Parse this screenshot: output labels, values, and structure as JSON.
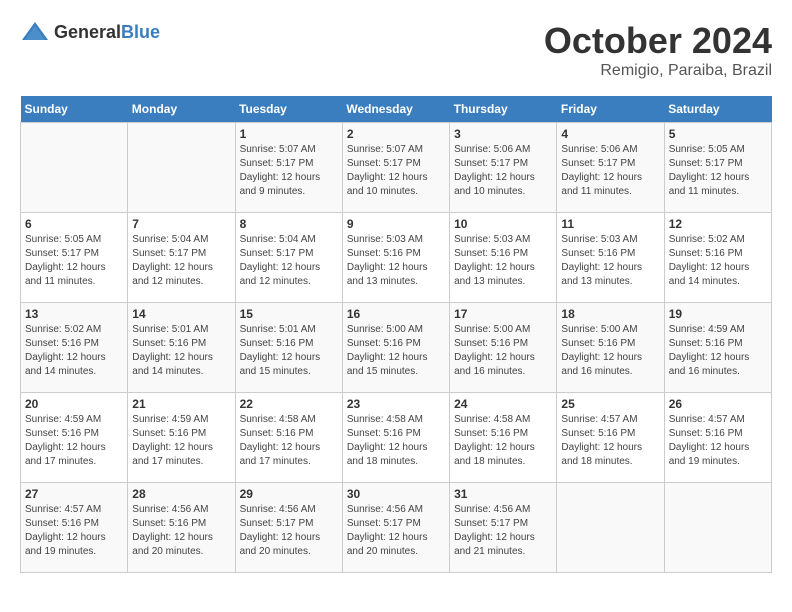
{
  "header": {
    "logo_general": "General",
    "logo_blue": "Blue",
    "title": "October 2024",
    "subtitle": "Remigio, Paraiba, Brazil"
  },
  "calendar": {
    "days_of_week": [
      "Sunday",
      "Monday",
      "Tuesday",
      "Wednesday",
      "Thursday",
      "Friday",
      "Saturday"
    ],
    "weeks": [
      [
        {
          "day": "",
          "sunrise": "",
          "sunset": "",
          "daylight": ""
        },
        {
          "day": "",
          "sunrise": "",
          "sunset": "",
          "daylight": ""
        },
        {
          "day": "1",
          "sunrise": "Sunrise: 5:07 AM",
          "sunset": "Sunset: 5:17 PM",
          "daylight": "Daylight: 12 hours and 9 minutes."
        },
        {
          "day": "2",
          "sunrise": "Sunrise: 5:07 AM",
          "sunset": "Sunset: 5:17 PM",
          "daylight": "Daylight: 12 hours and 10 minutes."
        },
        {
          "day": "3",
          "sunrise": "Sunrise: 5:06 AM",
          "sunset": "Sunset: 5:17 PM",
          "daylight": "Daylight: 12 hours and 10 minutes."
        },
        {
          "day": "4",
          "sunrise": "Sunrise: 5:06 AM",
          "sunset": "Sunset: 5:17 PM",
          "daylight": "Daylight: 12 hours and 11 minutes."
        },
        {
          "day": "5",
          "sunrise": "Sunrise: 5:05 AM",
          "sunset": "Sunset: 5:17 PM",
          "daylight": "Daylight: 12 hours and 11 minutes."
        }
      ],
      [
        {
          "day": "6",
          "sunrise": "Sunrise: 5:05 AM",
          "sunset": "Sunset: 5:17 PM",
          "daylight": "Daylight: 12 hours and 11 minutes."
        },
        {
          "day": "7",
          "sunrise": "Sunrise: 5:04 AM",
          "sunset": "Sunset: 5:17 PM",
          "daylight": "Daylight: 12 hours and 12 minutes."
        },
        {
          "day": "8",
          "sunrise": "Sunrise: 5:04 AM",
          "sunset": "Sunset: 5:17 PM",
          "daylight": "Daylight: 12 hours and 12 minutes."
        },
        {
          "day": "9",
          "sunrise": "Sunrise: 5:03 AM",
          "sunset": "Sunset: 5:16 PM",
          "daylight": "Daylight: 12 hours and 13 minutes."
        },
        {
          "day": "10",
          "sunrise": "Sunrise: 5:03 AM",
          "sunset": "Sunset: 5:16 PM",
          "daylight": "Daylight: 12 hours and 13 minutes."
        },
        {
          "day": "11",
          "sunrise": "Sunrise: 5:03 AM",
          "sunset": "Sunset: 5:16 PM",
          "daylight": "Daylight: 12 hours and 13 minutes."
        },
        {
          "day": "12",
          "sunrise": "Sunrise: 5:02 AM",
          "sunset": "Sunset: 5:16 PM",
          "daylight": "Daylight: 12 hours and 14 minutes."
        }
      ],
      [
        {
          "day": "13",
          "sunrise": "Sunrise: 5:02 AM",
          "sunset": "Sunset: 5:16 PM",
          "daylight": "Daylight: 12 hours and 14 minutes."
        },
        {
          "day": "14",
          "sunrise": "Sunrise: 5:01 AM",
          "sunset": "Sunset: 5:16 PM",
          "daylight": "Daylight: 12 hours and 14 minutes."
        },
        {
          "day": "15",
          "sunrise": "Sunrise: 5:01 AM",
          "sunset": "Sunset: 5:16 PM",
          "daylight": "Daylight: 12 hours and 15 minutes."
        },
        {
          "day": "16",
          "sunrise": "Sunrise: 5:00 AM",
          "sunset": "Sunset: 5:16 PM",
          "daylight": "Daylight: 12 hours and 15 minutes."
        },
        {
          "day": "17",
          "sunrise": "Sunrise: 5:00 AM",
          "sunset": "Sunset: 5:16 PM",
          "daylight": "Daylight: 12 hours and 16 minutes."
        },
        {
          "day": "18",
          "sunrise": "Sunrise: 5:00 AM",
          "sunset": "Sunset: 5:16 PM",
          "daylight": "Daylight: 12 hours and 16 minutes."
        },
        {
          "day": "19",
          "sunrise": "Sunrise: 4:59 AM",
          "sunset": "Sunset: 5:16 PM",
          "daylight": "Daylight: 12 hours and 16 minutes."
        }
      ],
      [
        {
          "day": "20",
          "sunrise": "Sunrise: 4:59 AM",
          "sunset": "Sunset: 5:16 PM",
          "daylight": "Daylight: 12 hours and 17 minutes."
        },
        {
          "day": "21",
          "sunrise": "Sunrise: 4:59 AM",
          "sunset": "Sunset: 5:16 PM",
          "daylight": "Daylight: 12 hours and 17 minutes."
        },
        {
          "day": "22",
          "sunrise": "Sunrise: 4:58 AM",
          "sunset": "Sunset: 5:16 PM",
          "daylight": "Daylight: 12 hours and 17 minutes."
        },
        {
          "day": "23",
          "sunrise": "Sunrise: 4:58 AM",
          "sunset": "Sunset: 5:16 PM",
          "daylight": "Daylight: 12 hours and 18 minutes."
        },
        {
          "day": "24",
          "sunrise": "Sunrise: 4:58 AM",
          "sunset": "Sunset: 5:16 PM",
          "daylight": "Daylight: 12 hours and 18 minutes."
        },
        {
          "day": "25",
          "sunrise": "Sunrise: 4:57 AM",
          "sunset": "Sunset: 5:16 PM",
          "daylight": "Daylight: 12 hours and 18 minutes."
        },
        {
          "day": "26",
          "sunrise": "Sunrise: 4:57 AM",
          "sunset": "Sunset: 5:16 PM",
          "daylight": "Daylight: 12 hours and 19 minutes."
        }
      ],
      [
        {
          "day": "27",
          "sunrise": "Sunrise: 4:57 AM",
          "sunset": "Sunset: 5:16 PM",
          "daylight": "Daylight: 12 hours and 19 minutes."
        },
        {
          "day": "28",
          "sunrise": "Sunrise: 4:56 AM",
          "sunset": "Sunset: 5:16 PM",
          "daylight": "Daylight: 12 hours and 20 minutes."
        },
        {
          "day": "29",
          "sunrise": "Sunrise: 4:56 AM",
          "sunset": "Sunset: 5:17 PM",
          "daylight": "Daylight: 12 hours and 20 minutes."
        },
        {
          "day": "30",
          "sunrise": "Sunrise: 4:56 AM",
          "sunset": "Sunset: 5:17 PM",
          "daylight": "Daylight: 12 hours and 20 minutes."
        },
        {
          "day": "31",
          "sunrise": "Sunrise: 4:56 AM",
          "sunset": "Sunset: 5:17 PM",
          "daylight": "Daylight: 12 hours and 21 minutes."
        },
        {
          "day": "",
          "sunrise": "",
          "sunset": "",
          "daylight": ""
        },
        {
          "day": "",
          "sunrise": "",
          "sunset": "",
          "daylight": ""
        }
      ]
    ]
  }
}
